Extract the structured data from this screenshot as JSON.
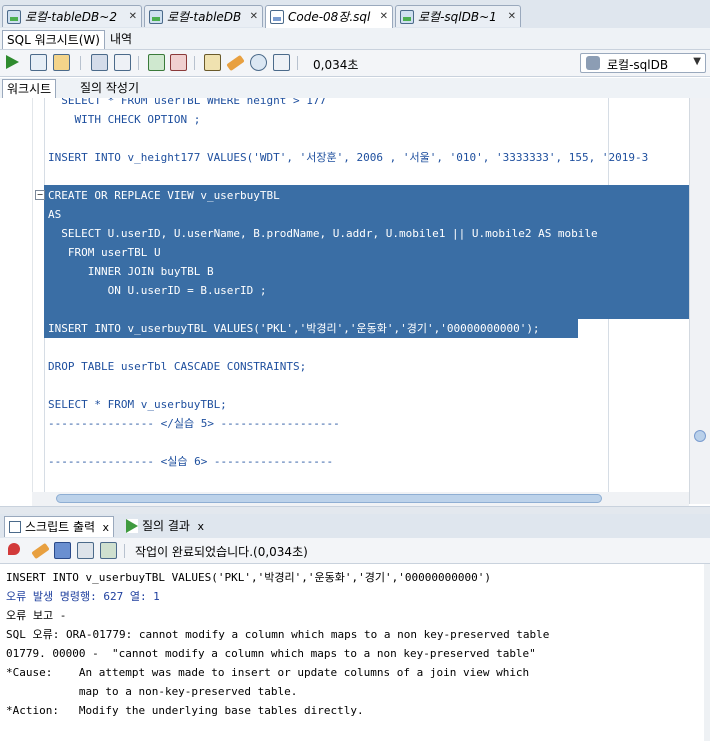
{
  "doc_tabs": [
    {
      "label": "로컬-tableDB~2",
      "icon": "db-connection-icon"
    },
    {
      "label": "로컬-tableDB",
      "icon": "db-connection-icon"
    },
    {
      "label": "Code-08장.sql",
      "icon": "sql-file-icon"
    },
    {
      "label": "로컬-sqlDB~1",
      "icon": "db-connection-icon"
    }
  ],
  "sub_tabs": [
    "SQL 워크시트(W)",
    "내역"
  ],
  "toolbar": {
    "timer": "0,034초",
    "connection": "로컬-sqlDB"
  },
  "worksheet_tabs": [
    "워크시트",
    "질의 작성기"
  ],
  "editor": {
    "lines": [
      {
        "text": "  SELECT * FROM userTBL WHERE height > 177",
        "partial": true
      },
      {
        "text": "    WITH CHECK OPTION ;"
      },
      {
        "text": ""
      },
      {
        "text": "INSERT INTO v_height177 VALUES('WDT', '서장훈', 2006 , '서울', '010', '3333333', 155, '2019-3"
      },
      {
        "text": ""
      },
      {
        "text": "CREATE OR REPLACE VIEW v_userbuyTBL",
        "selected": true
      },
      {
        "text": "AS",
        "selected": true
      },
      {
        "text": "  SELECT U.userID, U.userName, B.prodName, U.addr, U.mobile1 || U.mobile2 AS mobile",
        "selected": true
      },
      {
        "text": "   FROM userTBL U",
        "selected": true
      },
      {
        "text": "      INNER JOIN buyTBL B",
        "selected": true
      },
      {
        "text": "         ON U.userID = B.userID ;",
        "selected": true
      },
      {
        "text": "",
        "selected": true
      },
      {
        "text": "INSERT INTO v_userbuyTBL VALUES('PKL','박경리','운동화','경기','00000000000');",
        "selected": true
      },
      {
        "text": ""
      },
      {
        "text": "DROP TABLE userTbl CASCADE CONSTRAINTS;"
      },
      {
        "text": ""
      },
      {
        "text": "SELECT * FROM v_userbuyTBL;"
      },
      {
        "text": "---------------- </실습 5> ------------------"
      },
      {
        "text": ""
      },
      {
        "text": "---------------- <실습 6> ------------------"
      }
    ]
  },
  "output_tabs": [
    {
      "label": "스크립트 출력"
    },
    {
      "label": "질의 결과"
    }
  ],
  "output_status": "작업이 완료되었습니다.(0,034초)",
  "output_lines": [
    {
      "text": "INSERT INTO v_userbuyTBL VALUES('PKL','박경리','운동화','경기','00000000000')",
      "style": "normal"
    },
    {
      "text": "오류 발생 명령행: 627 열: 1",
      "style": "blue"
    },
    {
      "text": "오류 보고 -",
      "style": "normal"
    },
    {
      "text": "SQL 오류: ORA-01779: cannot modify a column which maps to a non key-preserved table",
      "style": "normal"
    },
    {
      "text": "01779. 00000 -  \"cannot modify a column which maps to a non key-preserved table\"",
      "style": "normal"
    },
    {
      "text": "*Cause:    An attempt was made to insert or update columns of a join view which",
      "style": "normal"
    },
    {
      "text": "           map to a non-key-preserved table.",
      "style": "normal"
    },
    {
      "text": "*Action:   Modify the underlying base tables directly.",
      "style": "normal"
    }
  ],
  "colors": {
    "selection": "#3a6ea5",
    "keyword": "#1e4f9e",
    "string": "#2c8a2c",
    "error_info": "#1e3f9e"
  }
}
